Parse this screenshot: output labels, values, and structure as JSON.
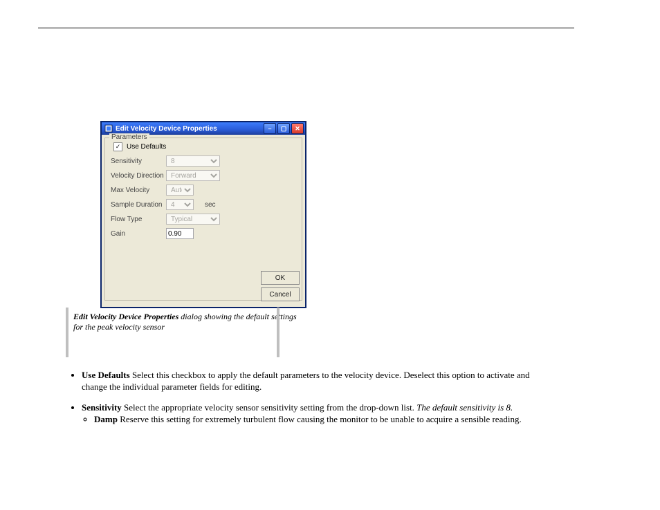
{
  "dialog": {
    "title": "Edit Velocity Device Properties",
    "group_label": "Parameters",
    "use_defaults_label": "Use Defaults",
    "use_defaults_checked": "✓",
    "fields": {
      "sensitivity": {
        "label": "Sensitivity",
        "value": "8"
      },
      "velocity_direction": {
        "label": "Velocity Direction",
        "value": "Forward"
      },
      "max_velocity": {
        "label": "Max Velocity",
        "value": "Auto"
      },
      "sample_duration": {
        "label": "Sample Duration",
        "value": "4",
        "unit": "sec"
      },
      "flow_type": {
        "label": "Flow Type",
        "value": "Typical"
      },
      "gain": {
        "label": "Gain",
        "value": "0.90"
      }
    },
    "buttons": {
      "ok": "OK",
      "cancel": "Cancel"
    }
  },
  "callout": {
    "bold": "Edit Velocity Device Properties",
    "suffix": " dialog showing the default settings for the peak velocity sensor"
  },
  "bullets": {
    "b1_term": "Use Defaults",
    "b1_text": "  Select this checkbox to apply the default parameters to the velocity device. Deselect this option to activate and change the individual parameter fields for editing.",
    "b2_term": "Sensitivity",
    "b2_text": "  Select the appropriate velocity sensor sensitivity setting from the drop-down list. ",
    "b2_ital": "The default sensitivity is 8.",
    "b2_sub_term": "Damp",
    "b2_sub_text": "  Reserve this setting for extremely turbulent flow causing the monitor to be unable to acquire a sensible reading."
  }
}
